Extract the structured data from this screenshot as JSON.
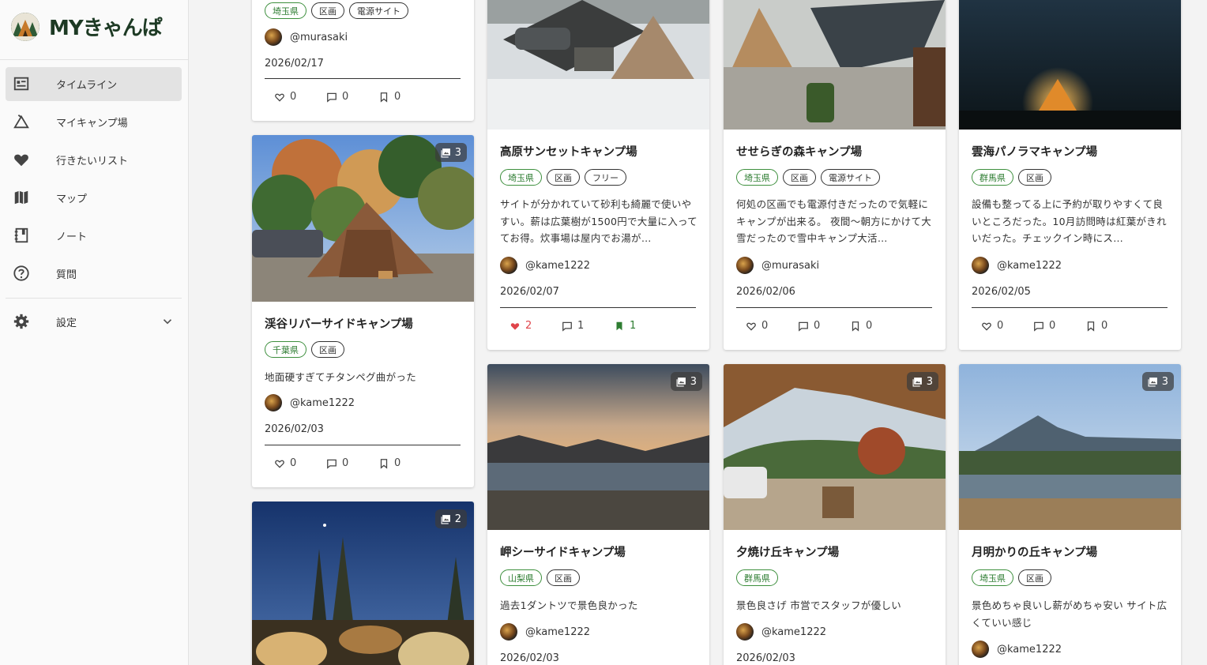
{
  "app": {
    "title": "MYきゃんぱ"
  },
  "sidebar": {
    "items": [
      {
        "label": "タイムライン",
        "icon": "timeline-icon"
      },
      {
        "label": "マイキャンプ場",
        "icon": "tent-icon"
      },
      {
        "label": "行きたいリスト",
        "icon": "heart-icon"
      },
      {
        "label": "マップ",
        "icon": "map-icon"
      },
      {
        "label": "ノート",
        "icon": "notebook-icon"
      },
      {
        "label": "質問",
        "icon": "help-icon"
      }
    ],
    "settings": {
      "label": "設定",
      "icon": "gear-icon"
    }
  },
  "posts": [
    {
      "title": "",
      "tags": [
        "埼玉県",
        "区画",
        "電源サイト"
      ],
      "user": "@murasaki",
      "date": "2026/02/17",
      "likes": "0",
      "comments": "0",
      "saves": "0"
    },
    {
      "title": "渓谷リバーサイドキャンプ場",
      "photo_count": "3",
      "tags": [
        "千葉県",
        "区画"
      ],
      "desc": "地面硬すぎてチタンペグ曲がった",
      "user": "@kame1222",
      "date": "2026/02/03",
      "likes": "0",
      "comments": "0",
      "saves": "0"
    },
    {
      "title": "",
      "photo_count": "2"
    },
    {
      "title": "高原サンセットキャンプ場",
      "tags": [
        "埼玉県",
        "区画",
        "フリー"
      ],
      "desc": "サイトが分かれていて砂利も綺麗で使いやすい。薪は広葉樹が1500円で大量に入っててお得。炊事場は屋内でお湯が…",
      "user": "@kame1222",
      "date": "2026/02/07",
      "likes": "2",
      "comments": "1",
      "saves": "1"
    },
    {
      "title": "せせらぎの森キャンプ場",
      "tags": [
        "埼玉県",
        "区画",
        "電源サイト"
      ],
      "desc": "何処の区画でも電源付きだったので気軽にキャンプが出来る。 夜間〜朝方にかけて大雪だったので雪中キャンプ大活…",
      "user": "@murasaki",
      "date": "2026/02/06",
      "likes": "0",
      "comments": "0",
      "saves": "0"
    },
    {
      "title": "雲海パノラマキャンプ場",
      "tags": [
        "群馬県",
        "区画"
      ],
      "desc": "設備も整ってる上に予約が取りやすくて良いところだった。10月訪問時は紅葉がきれいだった。チェックイン時にス…",
      "user": "@kame1222",
      "date": "2026/02/05",
      "likes": "0",
      "comments": "0",
      "saves": "0"
    },
    {
      "title": "岬シーサイドキャンプ場",
      "photo_count": "3",
      "tags": [
        "山梨県",
        "区画"
      ],
      "desc": "過去1ダントツで景色良かった",
      "user": "@kame1222",
      "date": "2026/02/03"
    },
    {
      "title": "夕焼け丘キャンプ場",
      "photo_count": "3",
      "tags": [
        "群馬県"
      ],
      "desc": "景色良さげ 市営でスタッフが優しい",
      "user": "@kame1222",
      "date": "2026/02/03"
    },
    {
      "title": "月明かりの丘キャンプ場",
      "photo_count": "3",
      "tags": [
        "埼玉県",
        "区画"
      ],
      "desc": "景色めちゃ良いし薪がめちゃ安い サイト広くていい感じ",
      "user": "@kame1222"
    }
  ],
  "colors": {
    "accent_green": "#2e7d32",
    "like_red": "#e0454b",
    "logo": "#1d3a24"
  }
}
